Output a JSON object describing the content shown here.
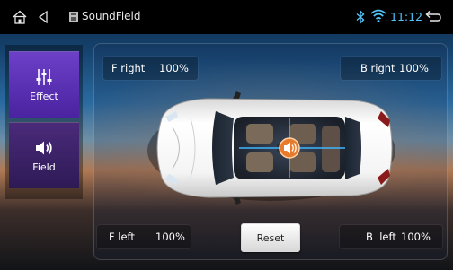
{
  "statusbar": {
    "title": "SoundField",
    "time": "11:12",
    "icons": {
      "home": "home-icon",
      "back": "back-triangle-icon",
      "app": "app-icon",
      "bluetooth": "bluetooth-icon",
      "wifi": "wifi-icon",
      "return": "return-arrow-icon"
    },
    "time_color": "#4fc3f7"
  },
  "sidebar": {
    "tabs": [
      {
        "label": "Effect",
        "icon": "equalizer-sliders-icon",
        "active": true
      },
      {
        "label": "Field",
        "icon": "speaker-volume-icon",
        "active": false
      }
    ],
    "active_color": "#6d40c8",
    "inactive_color": "#3a2068"
  },
  "soundfield": {
    "front_right": {
      "label": "F right",
      "value": "100%"
    },
    "back_right": {
      "label": "B right",
      "value": "100%"
    },
    "front_left": {
      "label": "F left",
      "value": "100%"
    },
    "back_left": {
      "label": "B  left",
      "value": "100%"
    },
    "reset_label": "Reset",
    "focus_marker_icon": "speaker-focus-icon",
    "marker_color": "#e87a2c"
  }
}
